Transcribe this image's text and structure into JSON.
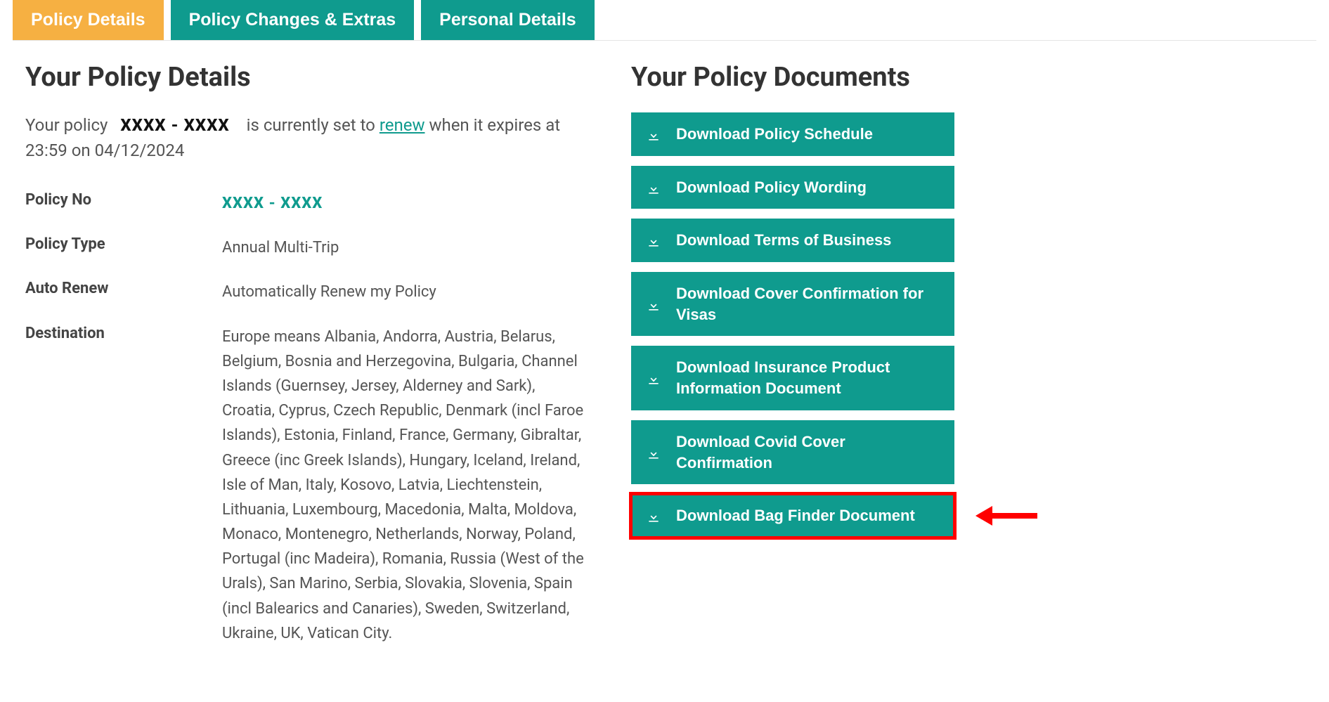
{
  "tabs": [
    {
      "label": "Policy Details",
      "active": true
    },
    {
      "label": "Policy Changes & Extras",
      "active": false
    },
    {
      "label": "Personal Details",
      "active": false
    }
  ],
  "left": {
    "heading": "Your Policy Details",
    "status_prefix": "Your policy ",
    "status_policy_ref": "XXXX - XXXX",
    "status_middle": " is currently set to ",
    "status_renew_word": "renew",
    "status_suffix": " when it expires at 23:59 on 04/12/2024",
    "rows": {
      "policy_no": {
        "label": "Policy No",
        "value": "XXXX - XXXX"
      },
      "policy_type": {
        "label": "Policy Type",
        "value": "Annual Multi-Trip"
      },
      "auto_renew": {
        "label": "Auto Renew",
        "value": "Automatically Renew my Policy"
      },
      "destination": {
        "label": "Destination",
        "value": "Europe means Albania, Andorra, Austria, Belarus, Belgium, Bosnia and Herzegovina, Bulgaria, Channel Islands (Guernsey, Jersey, Alderney and Sark), Croatia, Cyprus, Czech Republic, Denmark (incl Faroe Islands), Estonia, Finland, France, Germany, Gibraltar, Greece (inc Greek Islands), Hungary, Iceland, Ireland, Isle of Man, Italy, Kosovo, Latvia, Liechtenstein, Lithuania, Luxembourg, Macedonia, Malta, Moldova, Monaco, Montenegro, Netherlands, Norway, Poland, Portugal (inc Madeira), Romania, Russia (West of the Urals), San Marino, Serbia, Slovakia, Slovenia, Spain (incl Balearics and Canaries), Sweden, Switzerland, Ukraine, UK, Vatican City."
      }
    }
  },
  "right": {
    "heading": "Your Policy Documents",
    "documents": [
      {
        "label": "Download Policy Schedule"
      },
      {
        "label": "Download Policy Wording"
      },
      {
        "label": "Download Terms of Business"
      },
      {
        "label": "Download Cover Confirmation for Visas"
      },
      {
        "label": "Download Insurance Product Information Document"
      },
      {
        "label": "Download Covid Cover Confirmation"
      },
      {
        "label": "Download Bag Finder Document",
        "highlight": true
      }
    ]
  }
}
